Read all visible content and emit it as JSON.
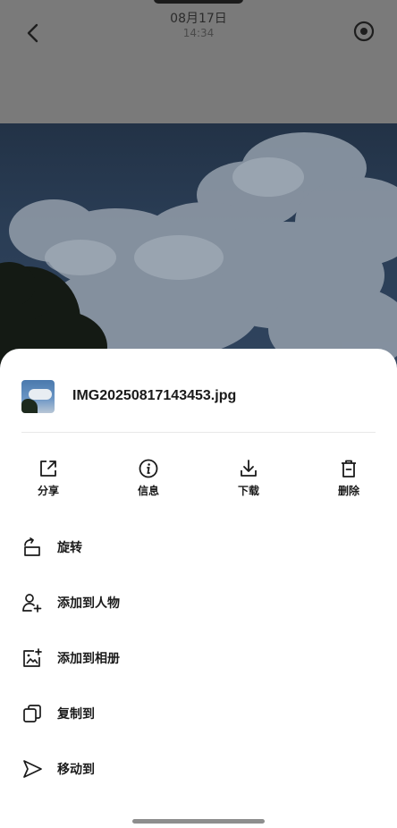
{
  "header": {
    "date": "08月17日",
    "time": "14:34",
    "back_icon": "chevron-left-icon",
    "more_icon": "circle-dot-icon"
  },
  "file": {
    "name": "IMG20250817143453.jpg"
  },
  "actions": [
    {
      "label": "分享",
      "icon": "share-icon"
    },
    {
      "label": "信息",
      "icon": "info-icon"
    },
    {
      "label": "下载",
      "icon": "download-icon"
    },
    {
      "label": "删除",
      "icon": "trash-icon"
    }
  ],
  "menu": [
    {
      "label": "旋转",
      "icon": "rotate-icon"
    },
    {
      "label": "添加到人物",
      "icon": "add-person-icon"
    },
    {
      "label": "添加到相册",
      "icon": "add-album-icon"
    },
    {
      "label": "复制到",
      "icon": "copy-icon"
    },
    {
      "label": "移动到",
      "icon": "move-icon"
    }
  ],
  "colors": {
    "sheet_bg": "#ffffff",
    "overlay": "#6f6f6f",
    "text": "#1a1a1a"
  }
}
